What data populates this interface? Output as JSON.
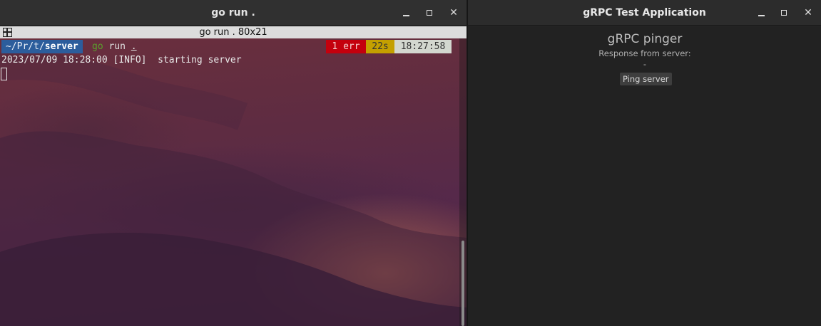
{
  "terminal_window": {
    "title": "go run .",
    "tab_title": "go run . 80x21",
    "prompt": {
      "path_prefix": "~/Pr/t/",
      "path_current": "server",
      "command_go": "go",
      "command_rest": " run ",
      "command_arg": ".",
      "status_err": "1 err",
      "status_duration": "22s",
      "status_time": "18:27:58"
    },
    "output_lines": [
      "2023/07/09 18:28:00 [INFO]  starting server"
    ],
    "controls": {
      "minimize": "–",
      "maximize": "□",
      "close": "✕"
    }
  },
  "app_window": {
    "title": "gRPC Test Application",
    "heading": "gRPC pinger",
    "response_label": "Response from server:",
    "response_value": "-",
    "ping_button_label": "Ping server",
    "controls": {
      "minimize": "–",
      "maximize": "□",
      "close": "✕"
    }
  },
  "colors": {
    "path_segment": "#2c5d9c",
    "error_segment": "#c4000d",
    "duration_segment": "#c4a000",
    "time_segment": "#d3d7cf",
    "go_keyword": "#5aa02c"
  }
}
